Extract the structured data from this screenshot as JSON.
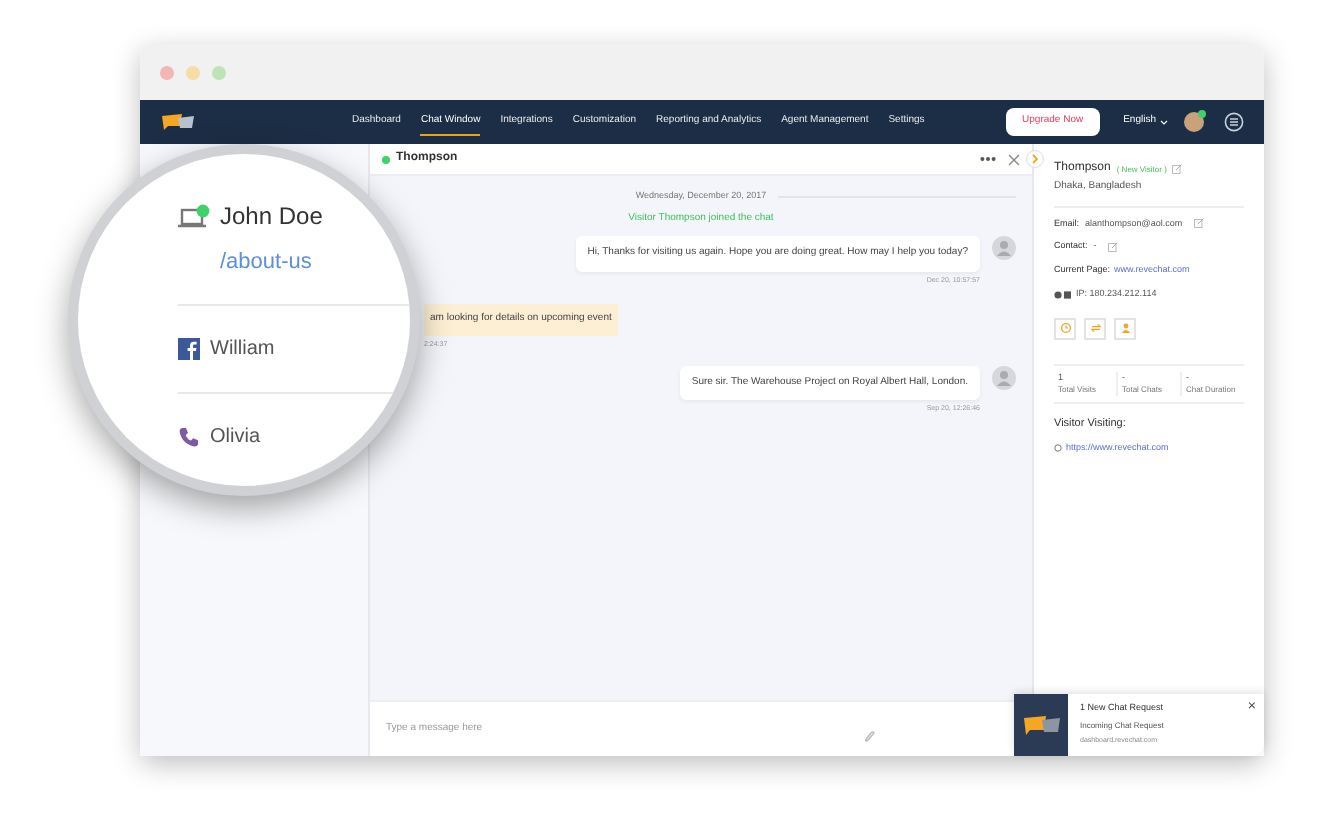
{
  "nav": {
    "items": [
      {
        "label": "Dashboard",
        "selected": false
      },
      {
        "label": "Chat Window",
        "selected": true
      },
      {
        "label": "Integrations",
        "selected": false
      },
      {
        "label": "Customization",
        "selected": false
      },
      {
        "label": "Reporting and Analytics",
        "selected": false
      },
      {
        "label": "Agent Management",
        "selected": false
      },
      {
        "label": "Settings",
        "selected": false
      }
    ],
    "upgrade": "Upgrade Now",
    "language": "English"
  },
  "magnifier": {
    "items": [
      {
        "kind": "web",
        "name": "John Doe",
        "page": "/about-us",
        "online": true
      },
      {
        "kind": "facebook",
        "name": "William"
      },
      {
        "kind": "phone",
        "name": "Olivia"
      }
    ]
  },
  "chat": {
    "visitor": "Thompson",
    "online": true,
    "date": "Wednesday, December 20, 2017",
    "messages": [
      {
        "kind": "system",
        "text": "Visitor Thompson joined the chat"
      },
      {
        "kind": "agent",
        "text": "Hi, Thanks for visiting us again. Hope you are doing great. How may I help you today?",
        "time": "Dec 20, 10:57:57"
      },
      {
        "kind": "visitor",
        "text": "am looking for details on upcoming event",
        "time": "2:24:37"
      },
      {
        "kind": "agent",
        "text": "Sure sir. The Warehouse Project on Royal Albert Hall, London.",
        "time": "Sep 20, 12:26:46"
      }
    ],
    "input_placeholder": "Type a message here"
  },
  "visitor_panel": {
    "name": "Thompson",
    "tag": "( New Visitor )",
    "location": "Dhaka, Bangladesh",
    "fields": [
      {
        "label": "Email:",
        "value": "alanthompson@aol.com",
        "kind": "editable"
      },
      {
        "label": "Contact:",
        "value": "-",
        "kind": "editable"
      },
      {
        "label": "Current Page:",
        "value": "www.revechat.com",
        "kind": "link"
      }
    ],
    "ip": "IP: 180.234.212.114",
    "stats": [
      {
        "value": "1",
        "label": "Total Visits"
      },
      {
        "value": "-",
        "label": "Total Chats"
      },
      {
        "value": "-",
        "label": "Chat Duration"
      }
    ],
    "visiting_title": "Visitor Visiting:",
    "visiting_url": "https://www.revechat.com"
  },
  "notification": {
    "title": "1 New Chat Request",
    "subtitle": "Incoming Chat Request",
    "source": "dashboard.revechat.com",
    "close": "×"
  }
}
